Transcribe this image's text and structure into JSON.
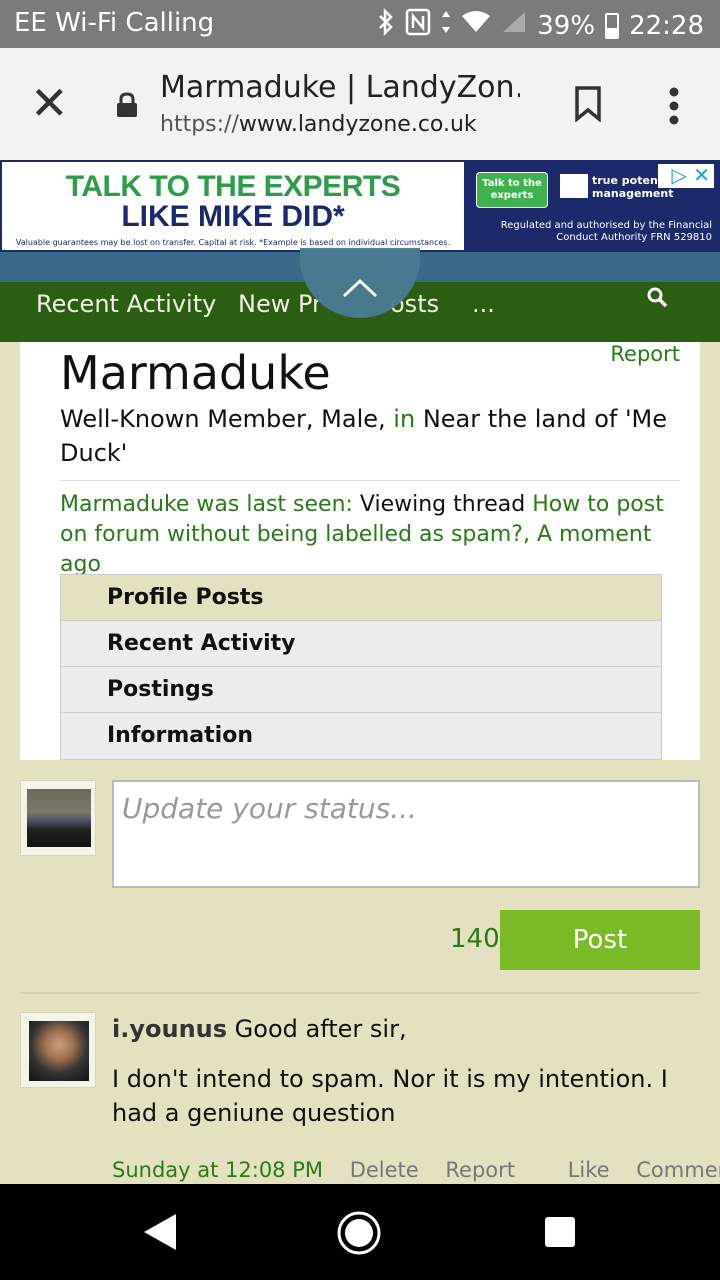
{
  "status_bar": {
    "carrier": "EE Wi-Fi Calling",
    "battery": "39%",
    "time": "22:28"
  },
  "browser": {
    "page_title": "Marmaduke | LandyZon…",
    "url_scheme": "https://",
    "url_host": "www.landyzone.co.uk"
  },
  "ad": {
    "headline1": "TALK TO THE EXPERTS",
    "headline2": "LIKE MIKE DID*",
    "fine_print": "Valuable guarantees may be lost on transfer. Capital at risk. *Example is based on individual circumstances.",
    "button": "Talk to the experts",
    "brand": "true potenti wealth management",
    "regulation": "Regulated and authorised by the Financial Conduct Authority FRN 529810"
  },
  "nav": {
    "items": [
      "Recent Activity",
      "New Pr",
      "osts",
      "..."
    ]
  },
  "profile": {
    "report": "Report",
    "name": "Marmaduke",
    "meta_prefix": "Well-Known Member, Male,",
    "meta_in": "in",
    "meta_location": "Near the land of 'Me Duck'",
    "last_seen_label": "Marmaduke was last seen:",
    "last_seen_action": "Viewing thread",
    "last_seen_thread": "How to post on forum without being labelled as spam?,",
    "last_seen_time": "A moment ago",
    "tabs": [
      "Profile Posts",
      "Recent Activity",
      "Postings",
      "Information"
    ]
  },
  "status_update": {
    "placeholder": "Update your status...",
    "char_count": "140",
    "post_label": "Post"
  },
  "comment": {
    "user": "i.younus",
    "greeting": "Good after sir,",
    "body": "I don't intend to spam. Nor it is my intention. I had a geniune question",
    "time": "Sunday at 12:08 PM",
    "delete": "Delete",
    "report": "Report",
    "like": "Like",
    "comment": "Comment"
  }
}
